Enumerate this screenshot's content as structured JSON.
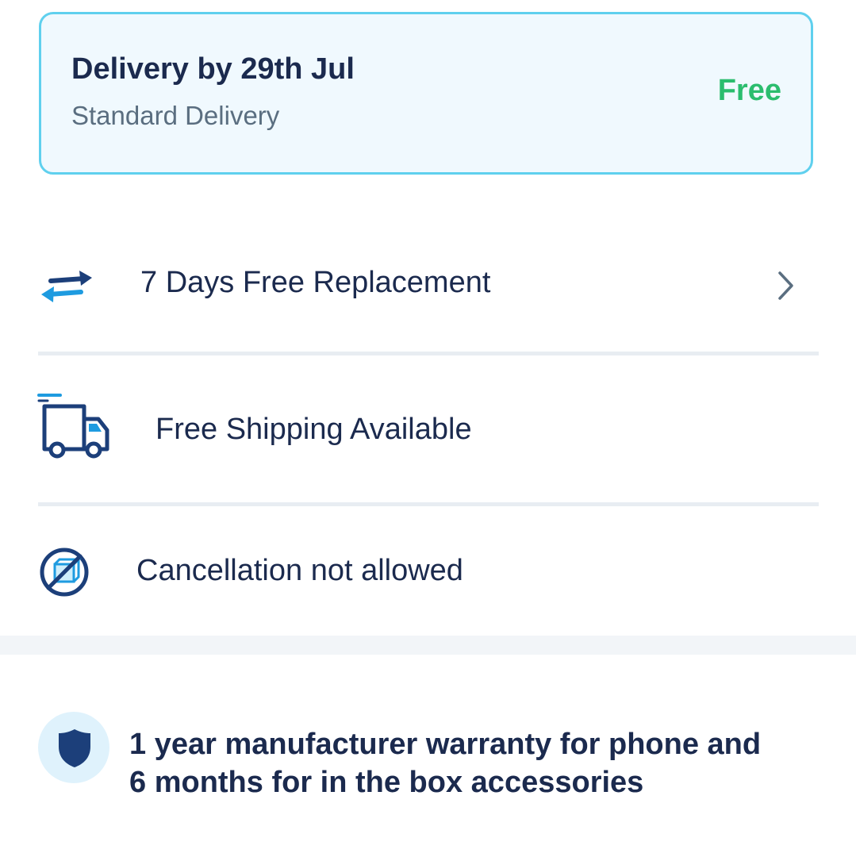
{
  "delivery": {
    "title": "Delivery by 29th Jul",
    "subtitle": "Standard Delivery",
    "price": "Free"
  },
  "features": {
    "replacement": {
      "label": "7 Days Free Replacement",
      "icon": "exchange-arrows-icon"
    },
    "shipping": {
      "label": "Free Shipping Available",
      "icon": "delivery-truck-icon"
    },
    "cancellation": {
      "label": "Cancellation not allowed",
      "icon": "no-cancellation-icon"
    }
  },
  "warranty": {
    "line1": "1 year manufacturer warranty for phone and",
    "line2": "6 months for in the box accessories",
    "icon": "shield-icon"
  },
  "colors": {
    "text_primary": "#1b2a4e",
    "text_secondary": "#5a6e80",
    "accent_green": "#2bbd6e",
    "card_border": "#5fd0ee",
    "card_bg": "#f0f9fe",
    "icon_blue": "#1e9be0",
    "icon_navy": "#1c3f7a"
  }
}
